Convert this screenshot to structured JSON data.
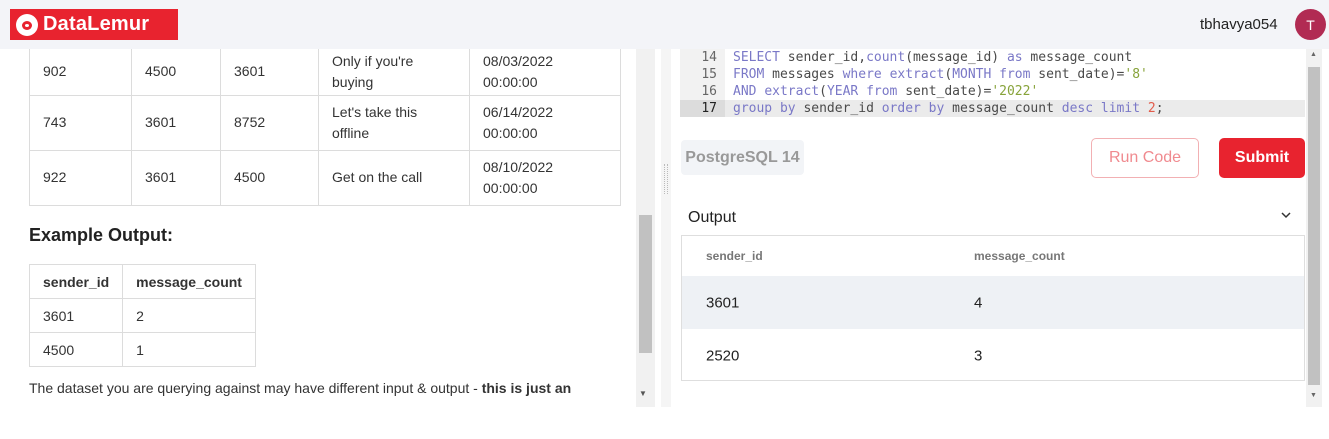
{
  "header": {
    "logo_text": "DataLemur",
    "username": "tbhavya054",
    "avatar_initial": "T"
  },
  "problem": {
    "input_rows": [
      [
        "902",
        "4500",
        "3601",
        "Only if you're buying",
        "08/03/2022 00:00:00"
      ],
      [
        "743",
        "3601",
        "8752",
        "Let's take this offline",
        "06/14/2022 00:00:00"
      ],
      [
        "922",
        "3601",
        "4500",
        "Get on the call",
        "08/10/2022 00:00:00"
      ]
    ],
    "example_output_heading": "Example Output:",
    "example_output": {
      "columns": [
        "sender_id",
        "message_count"
      ],
      "rows": [
        [
          "3601",
          "2"
        ],
        [
          "4500",
          "1"
        ]
      ]
    },
    "note_text": "The dataset you are querying against may have different input & output - ",
    "note_bold": "this is just an"
  },
  "editor": {
    "lines": [
      {
        "num": "14",
        "text": "SELECT sender_id,count(message_id) as message_count"
      },
      {
        "num": "15",
        "text": "FROM messages where extract(MONTH from sent_date)='8'"
      },
      {
        "num": "16",
        "text": "AND extract(YEAR from sent_date)='2022'"
      },
      {
        "num": "17",
        "text": "group by sender_id order by message_count desc limit 2;"
      }
    ],
    "dialect": "PostgreSQL 14",
    "run_label": "Run Code",
    "submit_label": "Submit"
  },
  "output": {
    "label": "Output",
    "columns": [
      "sender_id",
      "message_count"
    ],
    "rows": [
      [
        "3601",
        "4"
      ],
      [
        "2520",
        "3"
      ]
    ]
  },
  "colors": {
    "brand_red": "#e8232f",
    "avatar": "#b12b53"
  }
}
